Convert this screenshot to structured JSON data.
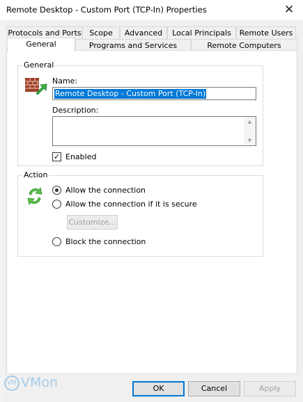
{
  "window": {
    "title": "Remote Desktop - Custom Port (TCP-In) Properties",
    "close_glyph": "✕"
  },
  "tabs": {
    "row1": [
      "Protocols and Ports",
      "Scope",
      "Advanced",
      "Local Principals",
      "Remote Users"
    ],
    "row2": [
      "General",
      "Programs and Services",
      "Remote Computers"
    ],
    "active": "General"
  },
  "general_group": {
    "legend": "General",
    "icon": "firewall-icon",
    "name_label": "Name:",
    "name_value": "Remote Desktop - Custom Port (TCP-In)",
    "description_label": "Description:",
    "description_value": "",
    "enabled_label": "Enabled",
    "enabled_checked": true
  },
  "action_group": {
    "legend": "Action",
    "icon": "action-arrows-icon",
    "options": [
      {
        "label": "Allow the connection",
        "selected": true
      },
      {
        "label": "Allow the connection if it is secure",
        "selected": false
      },
      {
        "label": "Block the connection",
        "selected": false
      }
    ],
    "customize_label": "Customize..."
  },
  "footer": {
    "ok_label": "OK",
    "cancel_label": "Cancel",
    "apply_label": "Apply"
  },
  "watermark": {
    "badge": "VM",
    "text": "VMon"
  },
  "colors": {
    "selection": "#0078d7",
    "dialog_bg": "#f0f0f0",
    "disabled_text": "#a0a0a0"
  }
}
